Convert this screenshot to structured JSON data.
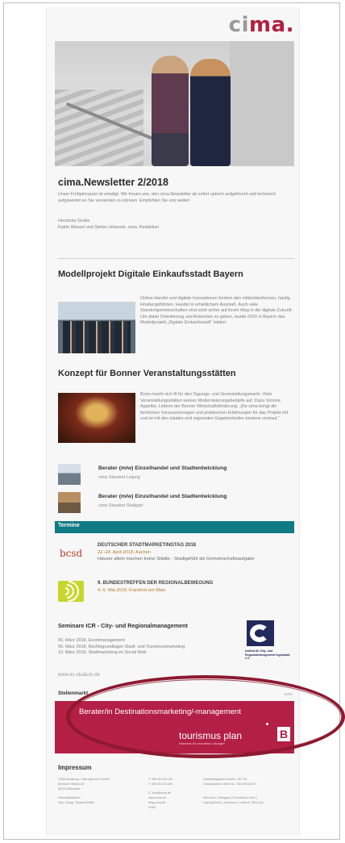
{
  "logo": {
    "prefix": "ci",
    "suffix": "ma."
  },
  "newsletter": {
    "title": "cima.Newsletter 2/2018",
    "intro": "Unser Frühjahrsputz ist erledigt. Wir freuen uns, den cima.Newsletter ab sofort optisch aufgefrischt und technisch aufgewertet an Sie versenden zu können. Empfehlen Sie uns weiter!",
    "greeting_line1": "Herzliche Grüße",
    "greeting_line2": "Katrin Wessel und Stefan Urbanski, cima. Redaktion"
  },
  "articles": [
    {
      "title": "Modellprojekt Digitale Einkaufsstadt Bayern",
      "text": "Online-Handel und digitale Innovationen fordern den mittelständischen, häufig inhabergeführten, Handel in erheblichem Ausmaß. Auch viele Standortgemeinschaften sind nicht sicher auf ihrem Weg in die digitale Zukunft. Um dabei Orientierung und Antworten zu geben, wurde 2016 in Bayern das Modellprojekt „Digitale Einkaufsstadt“ initiiert."
    },
    {
      "title": "Konzept für Bonner Veranstaltungsstätten",
      "text": "Bonn macht sich fit für den Tagungs- und Veranstaltungsmarkt. Viele Veranstaltungsstätten weisen Modernisierungsbedarfe auf. Dazu Victoria Appelbe, Leiterin der Bonner Wirtschaftsförderung: „Die cima bringt die fachlichen Voraussetzungen und praktischen Erfahrungen für das Projekt mit und ist mit den lokalen und regionalen Gegebenheiten bestens vertraut.“"
    }
  ],
  "jobs": [
    {
      "title": "Berater (m/w) Einzelhandel und Stadtentwicklung",
      "location": "cima Standort Leipzig"
    },
    {
      "title": "Berater (m/w) Einzelhandel und Stadtentwicklung",
      "location": "cima Standort Stuttgart"
    }
  ],
  "termine": {
    "label": "Termine",
    "events": [
      {
        "logo": "bcsd",
        "title": "DEUTSCHER STADTMARKETINGTAG 2018",
        "date": "22.-24. April 2018, Aachen",
        "sub": "Häuser allein machen keine Städte - Stadtgefühl als Gemeinschaftsaufgabe"
      },
      {
        "logo": "arcs-icon",
        "title": "9. BUNDESTREFFEN DER REGIONALBEWEGUNG",
        "date": "4.-5. Mai 2018, Frankfurt am Main",
        "sub": ""
      }
    ]
  },
  "seminars": {
    "title": "Seminare ICR - City- und Regionalmanagement",
    "items": [
      "05. März 2018, Eventmanagement",
      "06. März 2018, Rechtsgrundlagen Stadt- und Tourismusmarketing",
      "19. März 2018, Stadtmarketing im Social Web"
    ],
    "website": "www.icr-studium.de",
    "icr_caption": "Institut für City- und Regionalmanagement Ingolstadt e.V."
  },
  "stellenmarkt": {
    "label": "Stellenmarkt",
    "more": "mehr",
    "banner_title": "Berater/in Destinationsmarketing/-management",
    "brand": "tourismus plan",
    "brand_mark": "B",
    "brand_tag": "Netzwerk für innovative Lösungen"
  },
  "impressum": {
    "title": "Impressum",
    "col1": [
      "CIMA Beratung + Management GmbH",
      "Brienner Straße 45",
      "80333 München",
      "",
      "Geschäftsführer:",
      "Dipl.-Geogr. Roland Wölfel"
    ],
    "col2": [
      "T. 089 55 118 154",
      "F. 089 55 118 250",
      "",
      "E. info@cima.de",
      "www.cima.de",
      "blog.cima.de",
      "XING"
    ],
    "col3": [
      "Handelsregisternummer: 85 794",
      "Umsatzsteuer-Ident-Nr.: DE129314270",
      "",
      "",
      "München | Stuttgart | Forchheim | Köln |",
      "Leipzig Berlin | Hannover | Lübeck | Ried (A)"
    ]
  },
  "colors": {
    "brand": "#b0203f",
    "teal": "#0f7a84",
    "banner": "#b41f45",
    "highlight": "#8c1930"
  }
}
